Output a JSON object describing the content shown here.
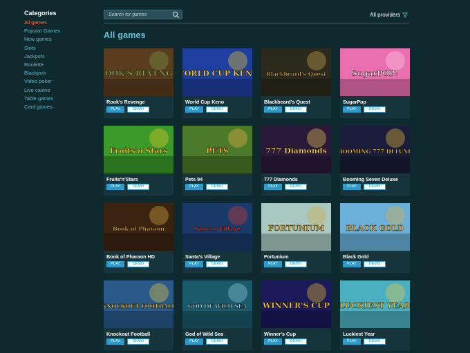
{
  "sidebar": {
    "heading": "Categories",
    "items": [
      {
        "label": "All games",
        "active": true
      },
      {
        "label": "Popular Games"
      },
      {
        "label": "New games"
      },
      {
        "label": "Slots"
      },
      {
        "label": "Jackpots"
      },
      {
        "label": "Roulette"
      },
      {
        "label": "Blackjack"
      },
      {
        "label": "Video poker"
      },
      {
        "label": "Live casino"
      },
      {
        "label": "Table games"
      },
      {
        "label": "Card games"
      }
    ]
  },
  "search": {
    "placeholder": "Search for games",
    "value": ""
  },
  "providers": {
    "label": "All providers"
  },
  "section_title": "All games",
  "buttons": {
    "play": "PLAY",
    "demo": "DEMO"
  },
  "games": [
    {
      "name": "Rook's Revenge",
      "art": "ROOK'S REVENGE",
      "bg": "#5a3d1f",
      "accent": "#7fa04a"
    },
    {
      "name": "World Cup Keno",
      "art": "WORLD CUP KENO",
      "bg": "#1f3fa0",
      "accent": "#ffd21f"
    },
    {
      "name": "Blackbeard's Quest",
      "art": "Blackbeard's Quest",
      "bg": "#2b2a1c",
      "accent": "#d9b25a"
    },
    {
      "name": "SugarPop",
      "art": "SugarPOP!",
      "bg": "#e96fb0",
      "accent": "#ffd3e8"
    },
    {
      "name": "Fruits'n'Stars",
      "art": "Fruits'n'Stars",
      "bg": "#3a9a2a",
      "accent": "#ffcf2a"
    },
    {
      "name": "Pets 94",
      "art": "PETS",
      "bg": "#4a7a2a",
      "accent": "#ffb84a"
    },
    {
      "name": "777 Diamonds",
      "art": "777 Diamonds",
      "bg": "#2a1a3a",
      "accent": "#ffd75a"
    },
    {
      "name": "Booming Seven Deluxe",
      "art": "BOOMING 777 DELUXE",
      "bg": "#1a1e3a",
      "accent": "#ffc93a"
    },
    {
      "name": "Book of Pharaon HD",
      "art": "Book of Pharaon",
      "bg": "#3a2410",
      "accent": "#e8b84a"
    },
    {
      "name": "Santa's Village",
      "art": "Santa's Village",
      "bg": "#1a3a6a",
      "accent": "#e83a2a"
    },
    {
      "name": "Fortunium",
      "art": "FORTUNIUM",
      "bg": "#a8c8c0",
      "accent": "#d9a83a"
    },
    {
      "name": "Black Gold",
      "art": "BLACK GOLD",
      "bg": "#6ab0d8",
      "accent": "#f0b030"
    },
    {
      "name": "Knockout Football",
      "art": "KNOCKOUT FOOTBALL",
      "bg": "#2a5a8a",
      "accent": "#ffd23a"
    },
    {
      "name": "God of Wild Sea",
      "art": "GOD OF WILD SEA",
      "bg": "#1a5a6a",
      "accent": "#9ae0f0"
    },
    {
      "name": "Winner's Cup",
      "art": "WINNER'S CUP",
      "bg": "#1a1a5a",
      "accent": "#ffcf2a"
    },
    {
      "name": "Luckiest Year",
      "art": "LUCKIEST YEAR",
      "bg": "#4ab0c0",
      "accent": "#f5c93a"
    }
  ]
}
